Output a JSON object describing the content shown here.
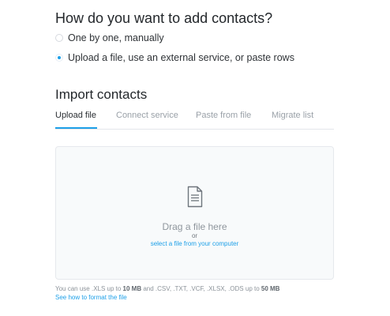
{
  "method_question": {
    "title": "How do you want to add contacts?",
    "options": [
      {
        "label": "One by one, manually",
        "selected": false
      },
      {
        "label": "Upload a file, use an external service, or paste rows",
        "selected": true
      }
    ]
  },
  "import": {
    "title": "Import contacts",
    "tabs": [
      {
        "label": "Upload file",
        "active": true
      },
      {
        "label": "Connect service",
        "active": false
      },
      {
        "label": "Paste from file",
        "active": false
      },
      {
        "label": "Migrate list",
        "active": false
      }
    ],
    "dropzone": {
      "icon": "document-icon",
      "main_text": "Drag a file here",
      "or_text": "or",
      "select_link": "select a file from your computer"
    },
    "note": {
      "part1": "You can use .XLS up to ",
      "xls_limit": "10 MB",
      "part2": " and .CSV, .TXT, .VCF, .XLSX, .ODS up to ",
      "other_limit": "50 MB"
    },
    "help_link": "See how to format the file"
  },
  "colors": {
    "accent": "#1ea0e8",
    "muted_text": "#9aa1a8",
    "dropzone_bg": "#f8fafb"
  }
}
